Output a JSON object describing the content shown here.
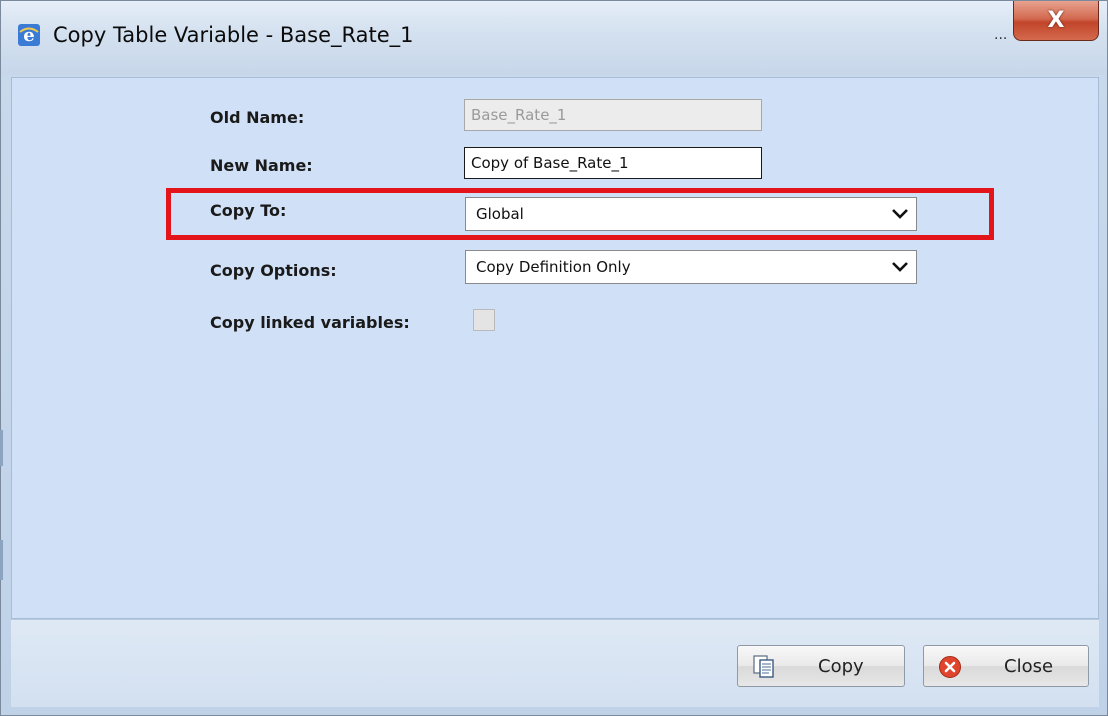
{
  "window": {
    "title": "Copy Table Variable - Base_Rate_1",
    "title_overflow": "...",
    "close_glyph": "X"
  },
  "form": {
    "old_name": {
      "label": "Old Name:",
      "value": "Base_Rate_1"
    },
    "new_name": {
      "label": "New Name:",
      "value": "Copy of Base_Rate_1"
    },
    "copy_to": {
      "label": "Copy To:",
      "value": "Global"
    },
    "copy_options": {
      "label": "Copy Options:",
      "value": "Copy Definition Only"
    },
    "copy_linked": {
      "label": "Copy linked variables:",
      "checked": false
    }
  },
  "buttons": {
    "copy_label": "Copy",
    "close_label": "Close"
  },
  "colors": {
    "highlight": "#e3151a",
    "content_bg": "#cfe0f7"
  },
  "icons": {
    "title": "internet-explorer-icon",
    "copy": "copy-documents-icon",
    "close": "red-x-circle-icon",
    "dropdown": "chevron-down-icon"
  }
}
